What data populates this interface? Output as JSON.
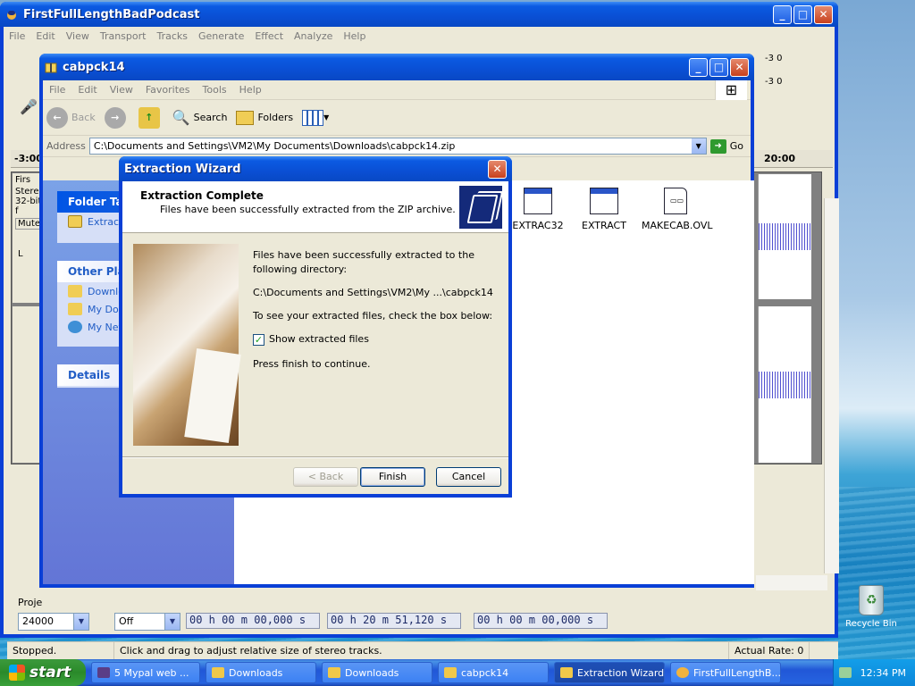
{
  "desktop": {
    "recycle_label": "Recycle Bin"
  },
  "audacity": {
    "title": "FirstFullLengthBadPodcast",
    "menu": [
      "File",
      "Edit",
      "View",
      "Transport",
      "Tracks",
      "Generate",
      "Effect",
      "Analyze",
      "Help"
    ],
    "ruler_left": "-3:00",
    "ruler_right": "20:00",
    "track_name": "Firs",
    "track_line1": "Stereo",
    "track_line2": "32-bit f",
    "mute": "Mute",
    "channel_l": "L",
    "meter_a": "-3 0",
    "meter_b": "-3 0",
    "project_rate_label": "Proje",
    "project_rate": "24000",
    "snap": "Off",
    "time1": "00 h 00 m 00,000 s",
    "time2": "00 h 20 m 51,120 s",
    "time3": "00 h 00 m 00,000 s",
    "status_left": "Stopped.",
    "status_mid": "Click and drag to adjust relative size of stereo tracks.",
    "status_right": "Actual Rate: 0"
  },
  "explorer": {
    "title": "cabpck14",
    "menu": [
      "File",
      "Edit",
      "View",
      "Favorites",
      "Tools",
      "Help"
    ],
    "back": "Back",
    "search": "Search",
    "folders": "Folders",
    "address_label": "Address",
    "address": "C:\\Documents and Settings\\VM2\\My Documents\\Downloads\\cabpck14.zip",
    "go": "Go",
    "folder_tasks": "Folder Tas",
    "extract_task": "Extract",
    "other_places": "Other Plac",
    "places": [
      "Downlo",
      "My Doc",
      "My Net"
    ],
    "details": "Details",
    "files": [
      "EXTRAC32",
      "EXTRACT",
      "MAKECAB.OVL"
    ]
  },
  "wizard": {
    "title": "Extraction Wizard",
    "heading": "Extraction Complete",
    "subheading": "Files have been successfully extracted from the ZIP archive.",
    "line1": "Files have been successfully extracted to the following directory:",
    "path": "C:\\Documents and Settings\\VM2\\My ...\\cabpck14",
    "line2": "To see your extracted files, check the box below:",
    "checkbox_label": "Show extracted files",
    "checkbox_checked": true,
    "line3": "Press finish to continue.",
    "back": "< Back",
    "finish": "Finish",
    "cancel": "Cancel"
  },
  "taskbar": {
    "start": "start",
    "items": [
      "5 Mypal web ...",
      "Downloads",
      "Downloads",
      "cabpck14",
      "Extraction Wizard",
      "FirstFullLengthB..."
    ],
    "clock": "12:34 PM"
  }
}
